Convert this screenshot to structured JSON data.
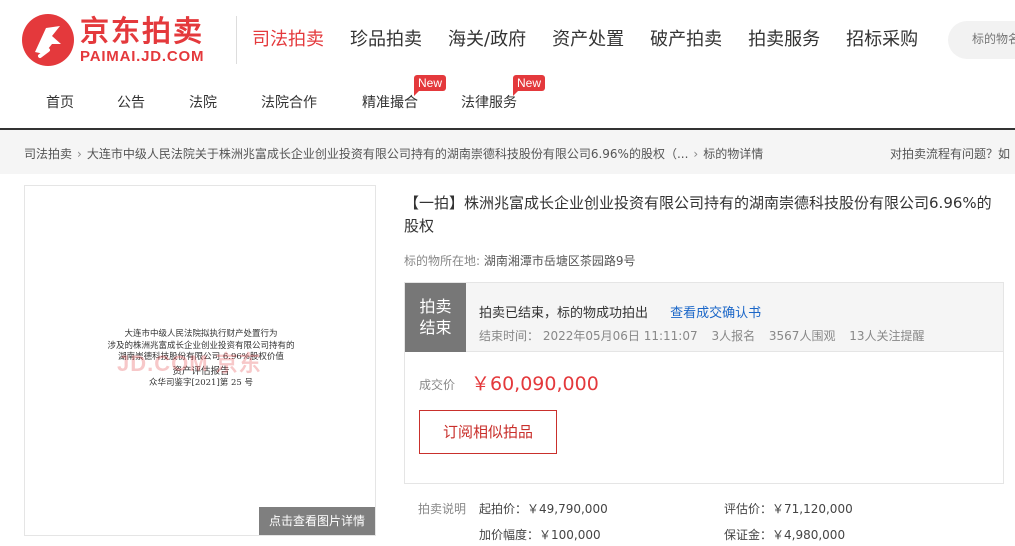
{
  "logo": {
    "cn": "京东拍卖",
    "en": "PAIMAI.JD.COM",
    "brand_color": "#e4393c"
  },
  "main_nav": [
    {
      "label": "司法拍卖",
      "active": true
    },
    {
      "label": "珍品拍卖"
    },
    {
      "label": "海关/政府"
    },
    {
      "label": "资产处置"
    },
    {
      "label": "破产拍卖"
    },
    {
      "label": "拍卖服务"
    },
    {
      "label": "招标采购"
    }
  ],
  "search": {
    "placeholder": "标的物名"
  },
  "sub_nav": [
    {
      "label": "首页"
    },
    {
      "label": "公告"
    },
    {
      "label": "法院"
    },
    {
      "label": "法院合作"
    },
    {
      "label": "精准撮合",
      "badge": "New"
    },
    {
      "label": "法律服务",
      "badge": "New"
    }
  ],
  "breadcrumb": {
    "items": [
      "司法拍卖",
      "大连市中级人民法院关于株洲兆富成长企业创业投资有限公司持有的湖南崇德科技股份有限公司6.96%的股权（...",
      "标的物详情"
    ],
    "help": "对拍卖流程有问题？如"
  },
  "image": {
    "doc_lines": [
      "大连市中级人民法院拟执行财产处置行为",
      "涉及的株洲兆富成长企业创业投资有限公司持有的",
      "湖南崇德科技股份有限公司 6.96%股权价值",
      "资产评估报告",
      "众华司鉴字[2021]第 25 号"
    ],
    "watermark": "JD.COM 京东",
    "detail_button": "点击查看图片详情"
  },
  "item": {
    "title": "【一拍】株洲兆富成长企业创业投资有限公司持有的湖南崇德科技股份有限公司6.96%的股权",
    "location_label": "标的物所在地:",
    "location": "湖南湘潭市岳塘区茶园路9号"
  },
  "status": {
    "tag_line1": "拍卖",
    "tag_line2": "结束",
    "message": "拍卖已结束，标的物成功拍出",
    "confirm_link": "查看成交确认书",
    "end_time": "结束时间：  2022年05月06日 11:11:07",
    "signups": "3人报名",
    "onlookers": "3567人围观",
    "reminders": "13人关注提醒"
  },
  "deal": {
    "price_label": "成交价",
    "price": "￥60,090,000",
    "subscribe_button": "订阅相似拍品"
  },
  "terms": {
    "label": "拍卖说明",
    "start_price": "起拍价：￥49,790,000",
    "increment": "加价幅度：￥100,000",
    "appraisal": "评估价：￥71,120,000",
    "deposit": "保证金：￥4,980,000"
  }
}
